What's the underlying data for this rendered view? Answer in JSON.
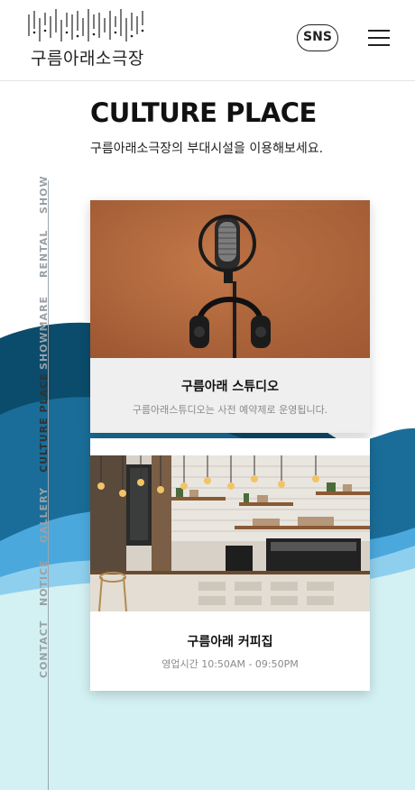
{
  "header": {
    "logo_text": "구름아래소극장",
    "sns_label": "SNS"
  },
  "page": {
    "title": "CULTURE PLACE",
    "subtitle": "구름아래소극장의 부대시설을 이용해보세요."
  },
  "side_nav": {
    "items": [
      {
        "label": "SHOW"
      },
      {
        "label": "RENTAL"
      },
      {
        "label": "SHOWMARE"
      },
      {
        "label": "CULTURE PLACE"
      },
      {
        "label": "GALLERY"
      },
      {
        "label": "NOTICE"
      },
      {
        "label": "CONTACT"
      }
    ],
    "active": "CULTURE PLACE"
  },
  "cards": [
    {
      "title": "구름아래 스튜디오",
      "desc": "구름아래스튜디오는 사전 예약제로 운영됩니다.",
      "image": "studio-microphone"
    },
    {
      "title": "구름아래 커피집",
      "desc": "영업시간 10:50AM - 09:50PM",
      "image": "coffee-shop-interior"
    }
  ],
  "colors": {
    "wave_dark": "#0f5677",
    "wave_mid": "#2f86b8",
    "wave_light": "#d3f1f3",
    "card_bg": "#efefef"
  }
}
